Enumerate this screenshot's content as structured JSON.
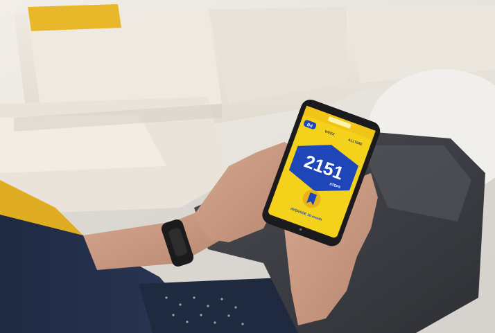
{
  "photo": {
    "colors": {
      "sofa": "#ece7dd",
      "sofa_shadow": "#d7d1c6",
      "cushion_yellow": "#e8b72a",
      "floor": "#cfccc6",
      "trousers": "#3b3d42",
      "shirt": "#243049",
      "skin": "#c99a82",
      "phone_body": "#1b1b1d",
      "screen_yellow": "#f4d21c",
      "screen_blue": "#1f46b8"
    }
  },
  "phone_screen": {
    "tab_active": "Bd",
    "tab_2": "WEEK",
    "tab_3": "ALLTIME",
    "big_number": "2151",
    "big_number_unit": "STEPS",
    "badge_caption": "AVERAGE 10 month"
  }
}
